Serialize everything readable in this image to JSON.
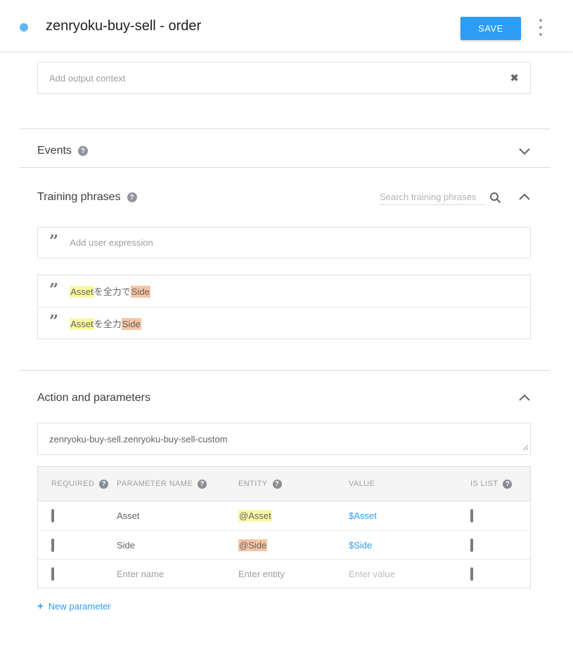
{
  "header": {
    "title": "zenryoku-buy-sell - order",
    "save_label": "SAVE"
  },
  "icons": {
    "close": "✖",
    "help": "?",
    "plus": "+",
    "quote": "”"
  },
  "output_context": {
    "placeholder": "Add output context"
  },
  "events": {
    "title": "Events"
  },
  "training_phrases": {
    "title": "Training phrases",
    "search_placeholder": "Search training phrases",
    "add_placeholder": "Add user expression",
    "phrases": [
      {
        "parts": [
          {
            "text": "Asset",
            "highlight": "yellow"
          },
          {
            "text": "を全力で",
            "highlight": "none"
          },
          {
            "text": "Side",
            "highlight": "orange"
          }
        ]
      },
      {
        "parts": [
          {
            "text": "Asset",
            "highlight": "yellow"
          },
          {
            "text": "を全力",
            "highlight": "none"
          },
          {
            "text": "Side",
            "highlight": "orange"
          }
        ]
      }
    ]
  },
  "action_parameters": {
    "title": "Action and parameters",
    "action_value": "zenryoku-buy-sell.zenryoku-buy-sell-custom",
    "table": {
      "columns": {
        "required": "REQUIRED",
        "parameter_name": "PARAMETER NAME",
        "entity": "ENTITY",
        "value": "VALUE",
        "is_list": "IS LIST"
      },
      "rows": [
        {
          "required_checked": false,
          "name": "Asset",
          "entity": "@Asset",
          "entity_highlight": "yellow",
          "value": "$Asset",
          "is_list_checked": false
        },
        {
          "required_checked": false,
          "name": "Side",
          "entity": "@Side",
          "entity_highlight": "orange",
          "value": "$Side",
          "is_list_checked": false
        },
        {
          "required_checked": false,
          "name_placeholder": "Enter name",
          "entity_placeholder": "Enter entity",
          "value_placeholder": "Enter value",
          "is_list_checked": false
        }
      ]
    },
    "new_parameter_label": "New parameter"
  },
  "colors": {
    "accent_blue": "#2D9CF4",
    "intent_dot_blue": "#64B5F6",
    "highlight_yellow": "#FCF8A3",
    "highlight_orange": "#F6C5A3"
  }
}
